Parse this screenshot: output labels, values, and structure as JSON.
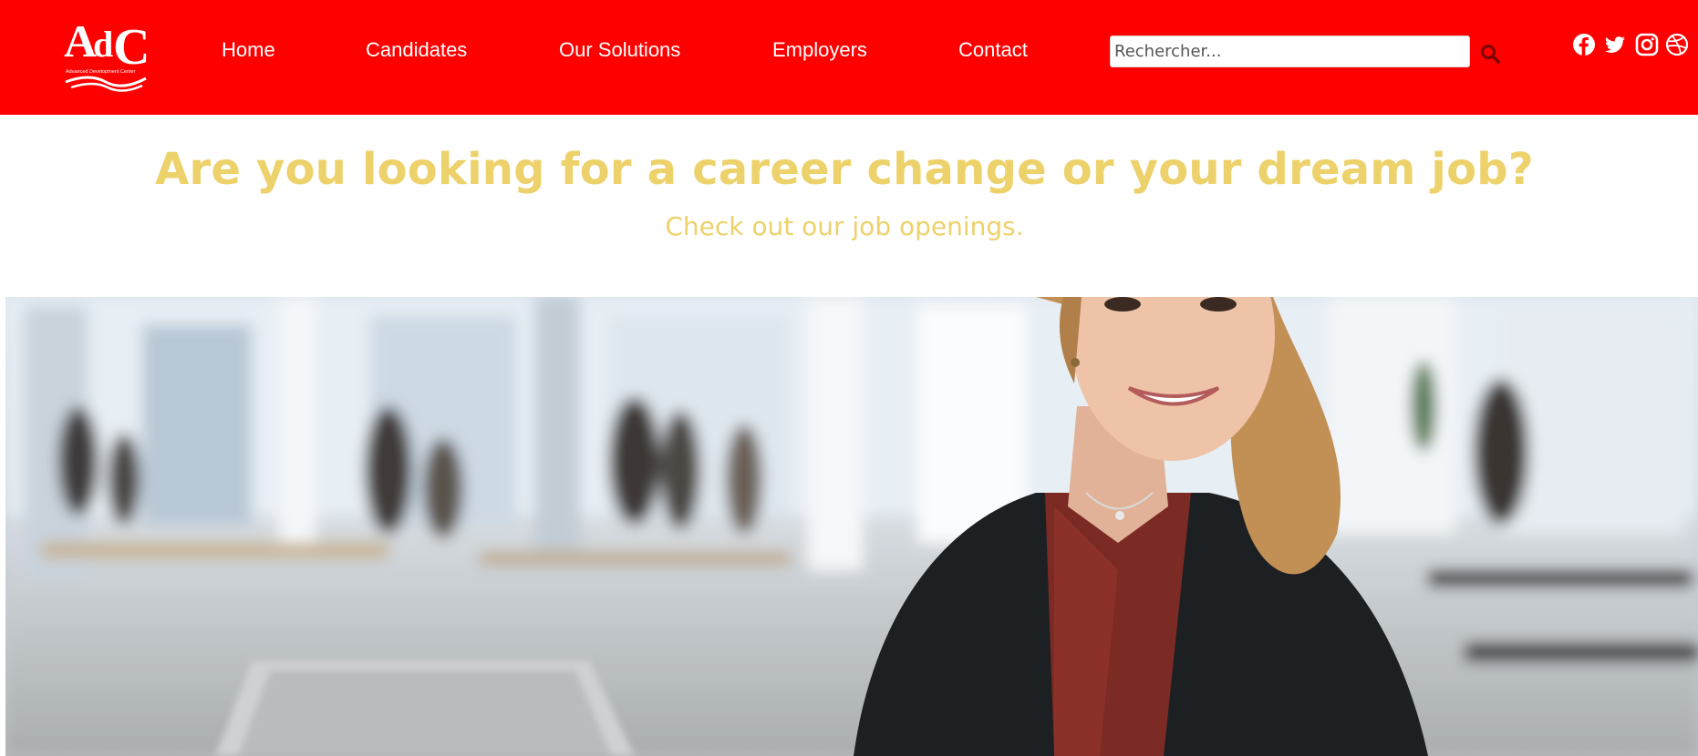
{
  "brand": {
    "logo_text": "AdC",
    "logo_tagline": "Advanced Development Center"
  },
  "nav": {
    "items": [
      {
        "label": "Home"
      },
      {
        "label": "Candidates"
      },
      {
        "label": "Our Solutions"
      },
      {
        "label": "Employers"
      },
      {
        "label": "Contact"
      }
    ]
  },
  "search": {
    "placeholder": "Rechercher...",
    "value": "",
    "icon": "search-icon"
  },
  "social": [
    {
      "icon": "facebook-icon"
    },
    {
      "icon": "twitter-icon"
    },
    {
      "icon": "instagram-icon"
    },
    {
      "icon": "dribbble-icon"
    }
  ],
  "hero": {
    "title": "Are you looking for a career change or your dream job?",
    "subtitle": "Check out our job openings."
  },
  "colors": {
    "header_bg": "#ff0000",
    "accent_text": "#edd16a",
    "nav_text": "#ffffff"
  }
}
